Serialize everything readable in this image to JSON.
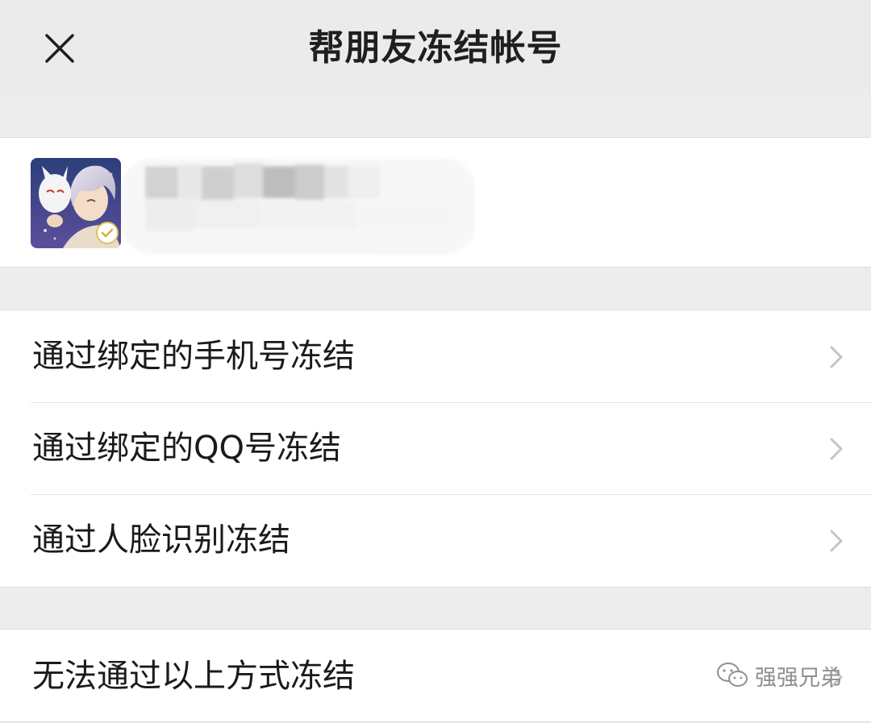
{
  "nav": {
    "title": "帮朋友冻结帐号",
    "close_icon": "close-icon"
  },
  "account": {
    "avatar": "anime-avatar",
    "name_blurred": true,
    "verified_icon": "check-badge-icon"
  },
  "menu": {
    "options": [
      {
        "label": "通过绑定的手机号冻结",
        "icon": "chevron-right-icon"
      },
      {
        "label": "通过绑定的QQ号冻结",
        "icon": "chevron-right-icon"
      },
      {
        "label": "通过人脸识别冻结",
        "icon": "chevron-right-icon"
      }
    ],
    "fallback": {
      "label": "无法通过以上方式冻结",
      "icon": "chevron-right-icon"
    }
  },
  "watermark": {
    "text": "强强兄弟",
    "icon": "wechat-icon"
  },
  "colors": {
    "background": "#ededed",
    "card": "#ffffff",
    "text": "#1a1a1a",
    "chevron": "#c4c4c4"
  }
}
